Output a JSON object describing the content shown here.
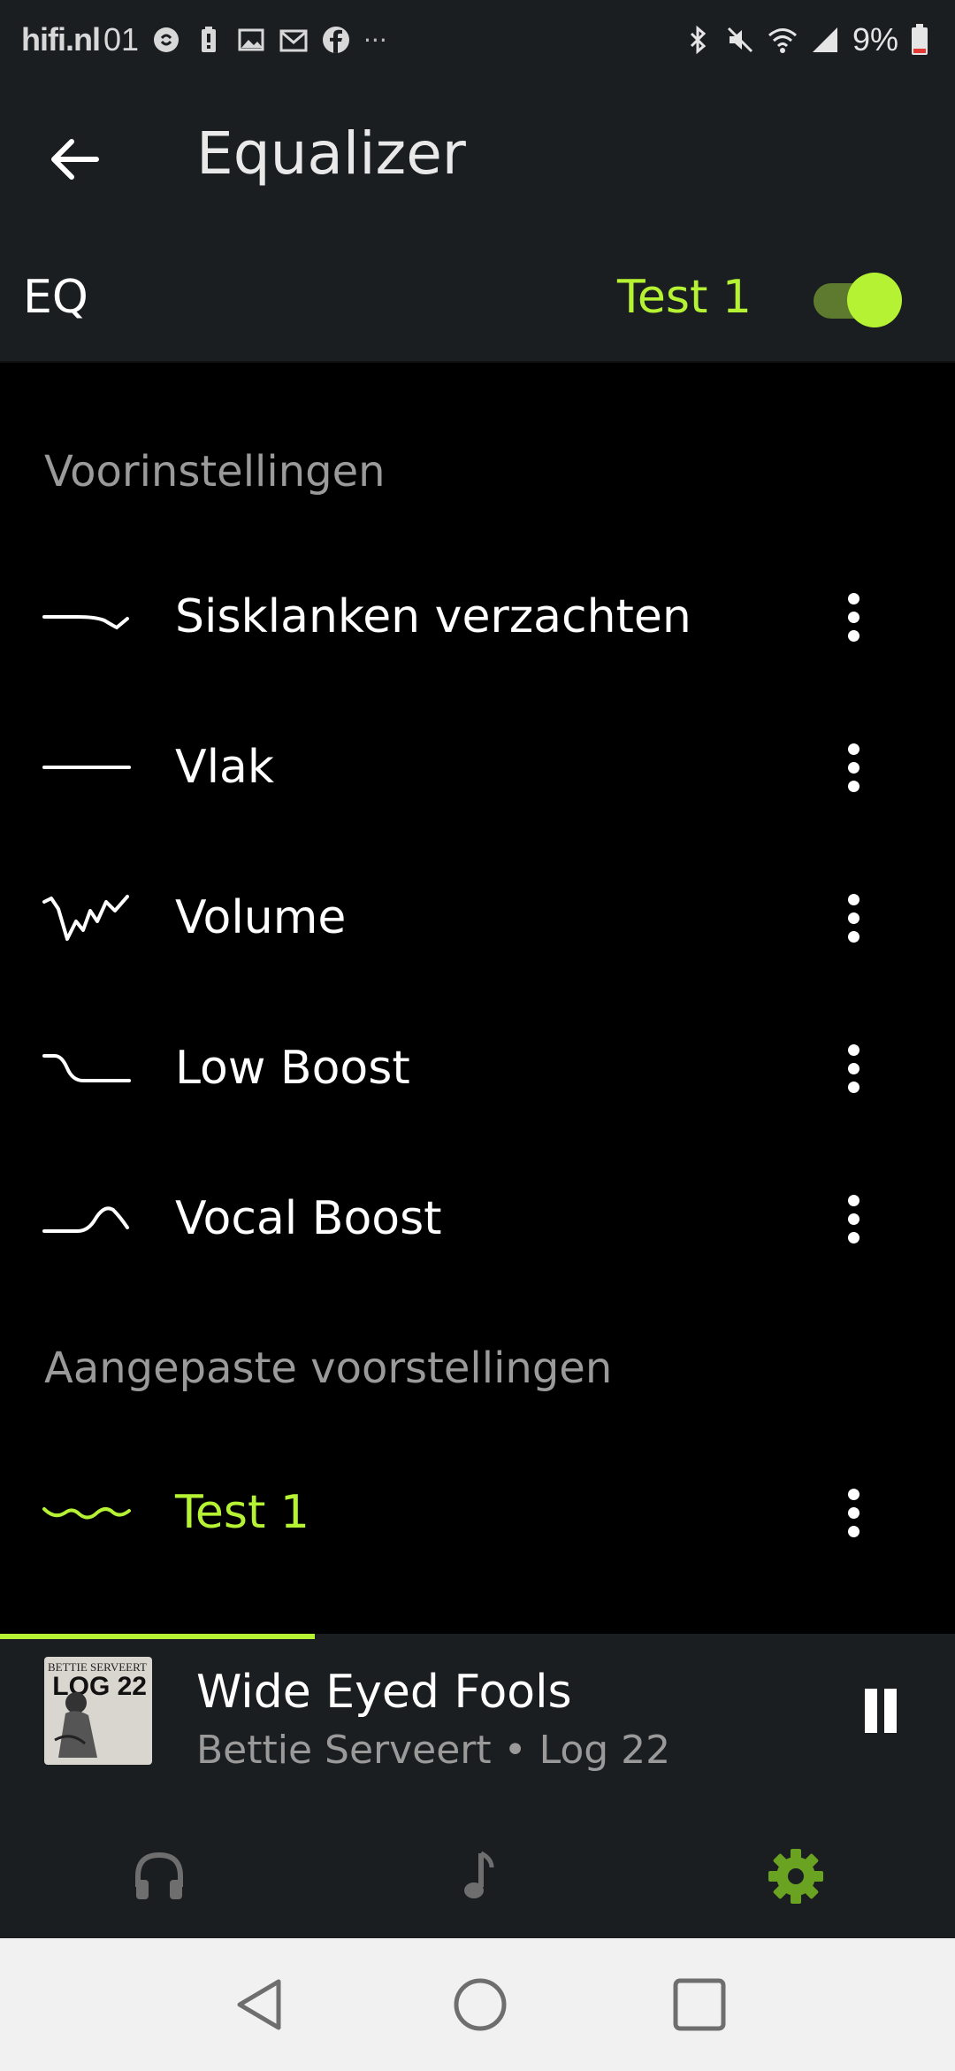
{
  "status_bar": {
    "brand": "hifi.nl",
    "time": "01",
    "battery": "9%",
    "overflow": "···",
    "icons": [
      "shazam-icon",
      "battery-saver-icon",
      "gallery-icon",
      "gmail-icon",
      "facebook-icon",
      "bluetooth-icon",
      "mute-icon",
      "wifi-icon",
      "signal-icon",
      "battery-icon"
    ]
  },
  "app_bar": {
    "title": "Equalizer",
    "back_icon": "arrow-left-icon"
  },
  "eq": {
    "label": "EQ",
    "current_preset": "Test 1",
    "enabled": true
  },
  "sections": {
    "presets_header": "Voorinstellingen",
    "custom_header": "Aangepaste voorstellingen"
  },
  "presets": [
    {
      "label": "Sisklanken verzachten",
      "curve": "de-ess-curve-icon"
    },
    {
      "label": "Vlak",
      "curve": "flat-curve-icon"
    },
    {
      "label": "Volume",
      "curve": "volume-curve-icon"
    },
    {
      "label": "Low Boost",
      "curve": "low-boost-curve-icon"
    },
    {
      "label": "Vocal Boost",
      "curve": "vocal-boost-curve-icon"
    }
  ],
  "custom_presets": [
    {
      "label": "Test 1",
      "curve": "custom-curve-icon",
      "active": true
    }
  ],
  "player": {
    "title": "Wide Eyed Fools",
    "subtitle": "Bettie Serveert • Log 22",
    "album_art_top": "BETTIE SERVEERT",
    "album_art_title": "LOG 22",
    "progress": 0.33
  },
  "bottom_nav": [
    {
      "name": "headphones-icon",
      "active": false
    },
    {
      "name": "music-note-icon",
      "active": false
    },
    {
      "name": "settings-gear-icon",
      "active": true
    }
  ],
  "colors": {
    "accent": "#b6f234",
    "surface": "#1b1e21",
    "background": "#000000",
    "muted_text": "#9a9a9a",
    "settings_active": "#6aa321"
  }
}
